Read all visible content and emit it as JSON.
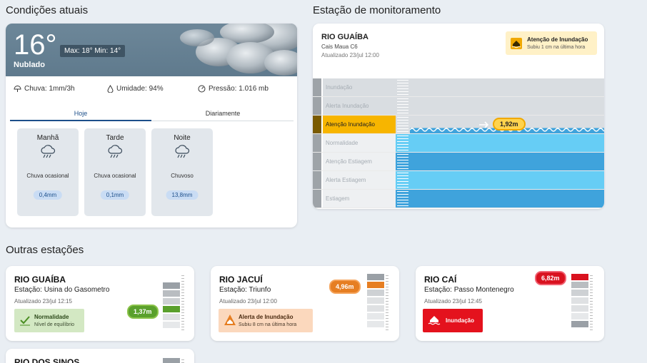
{
  "current": {
    "section_title": "Condições atuais",
    "temperature": "16°",
    "condition": "Nublado",
    "maxmin": "Max: 18° Min: 14°",
    "rain": "Chuva: 1mm/3h",
    "humidity": "Umidade: 94%",
    "pressure": "Pressão: 1.016 mb",
    "tabs": [
      {
        "label": "Hoje",
        "active": true
      },
      {
        "label": "Diariamente",
        "active": false
      }
    ],
    "periods": [
      {
        "name": "Manhã",
        "icon": "rain-cloud-icon",
        "desc": "Chuva ocasional",
        "rain": "0,4mm"
      },
      {
        "name": "Tarde",
        "icon": "rain-cloud-icon",
        "desc": "Chuva ocasional",
        "rain": "0,1mm"
      },
      {
        "name": "Noite",
        "icon": "rain-cloud-icon",
        "desc": "Chuvoso",
        "rain": "13,8mm"
      }
    ]
  },
  "monitor": {
    "section_title": "Estação de monitoramento",
    "river": "RIO GUAÍBA",
    "station": "Cais Maua C6",
    "updated": "Atualizado 23/jul 12:00",
    "alert_title": "Atenção de Inundação",
    "alert_sub": "Subiu 1 cm na última hora",
    "level_value": "1,92m",
    "levels": [
      {
        "label": "Inundação",
        "active": false
      },
      {
        "label": "Alerta Inundação",
        "active": false
      },
      {
        "label": "Atenção Inundação",
        "active": true
      },
      {
        "label": "Normalidade",
        "active": false
      },
      {
        "label": "Atenção Estiagem",
        "active": false
      },
      {
        "label": "Alerta Estiagem",
        "active": false
      },
      {
        "label": "Estiagem",
        "active": false
      }
    ],
    "colors": {
      "active": "#f7b500",
      "water_light": "#66cdf5",
      "water_dark": "#3fa3dc",
      "dry": "#d9dde1"
    }
  },
  "others": {
    "section_title": "Outras estações",
    "stations": [
      {
        "river": "RIO GUAÍBA",
        "station": "Estação: Usina do Gasometro",
        "updated": "Atualizado 23/jul 12:15",
        "level": "1,37m",
        "status": "Normalidade",
        "status_sub": "Nível de equilíbrio",
        "color": "#5aa02c"
      },
      {
        "river": "RIO JACUÍ",
        "station": "Estação: Triunfo",
        "updated": "Atualizado 23/jul 12:00",
        "level": "4,96m",
        "status": "Alerta de Inundação",
        "status_sub": "Subiu 8 cm na última hora",
        "color": "#e67e22"
      },
      {
        "river": "RIO CAÍ",
        "station": "Estação: Passo Montenegro",
        "updated": "Atualizado 23/jul 12:45",
        "level": "6,82m",
        "status": "Inundação",
        "status_sub": "",
        "color": "#d9121f"
      }
    ],
    "partial_river": "RIO DOS SINOS"
  }
}
